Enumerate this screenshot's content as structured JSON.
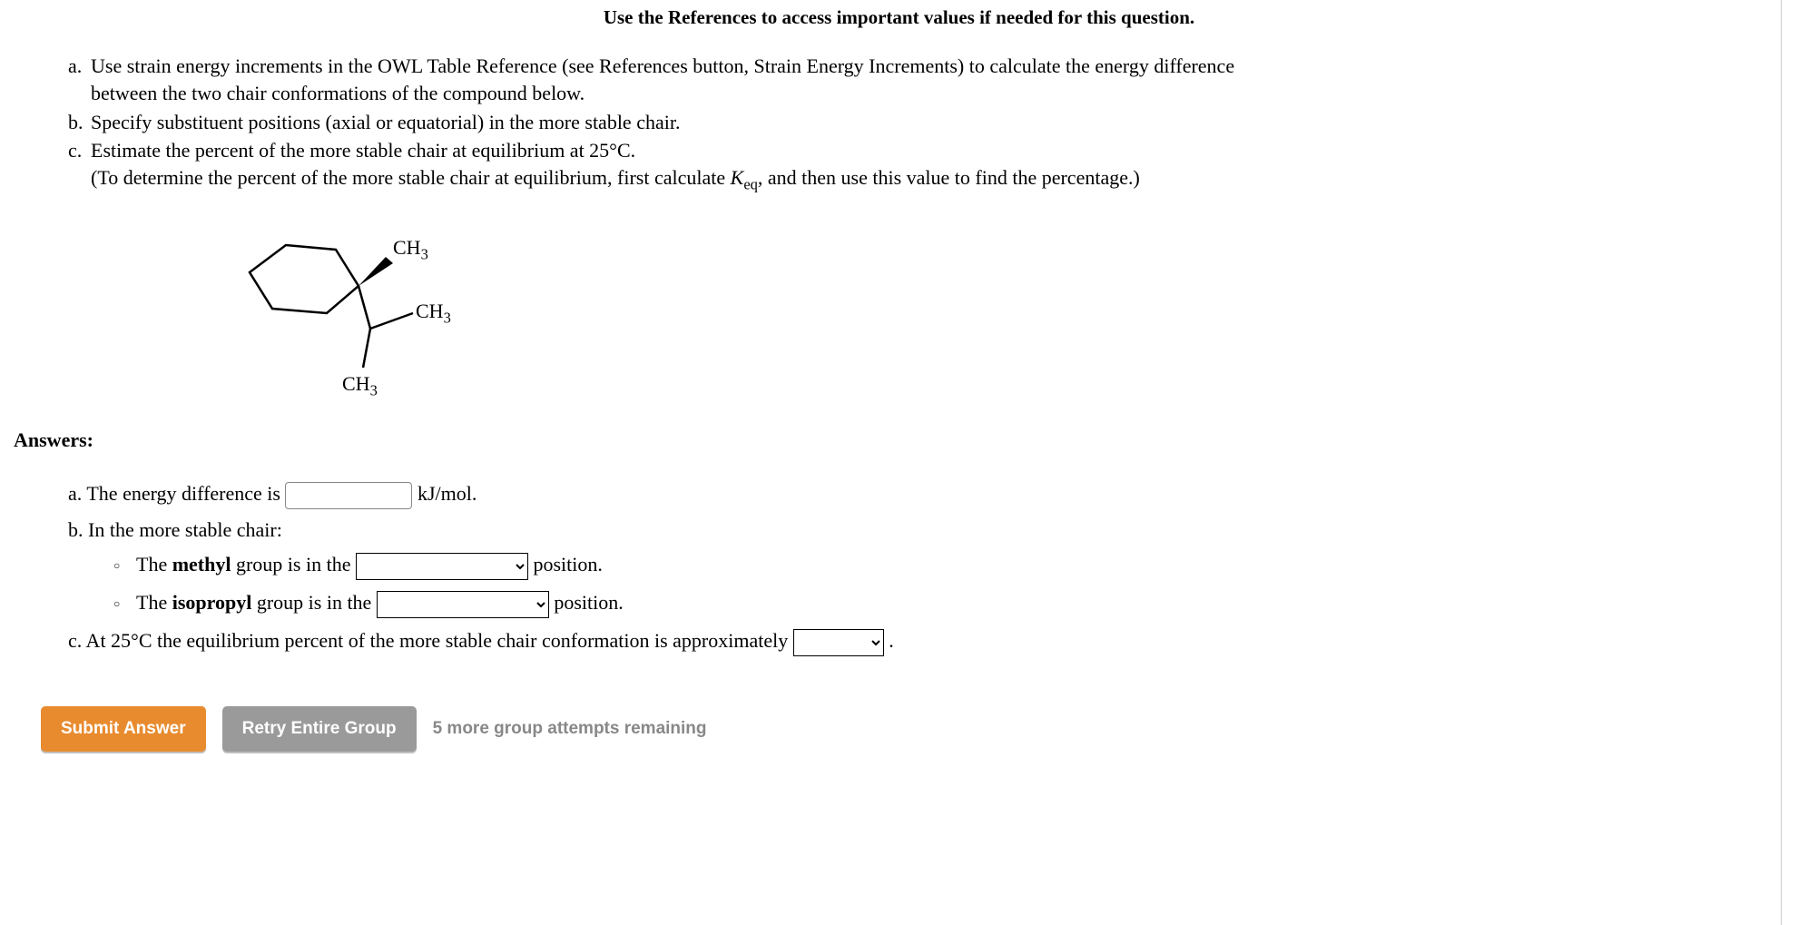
{
  "header": "Use the References to access important values if needed for this question.",
  "questions": {
    "a_letter": "a.",
    "a_text1": "Use strain energy increments in the OWL Table Reference (see References button, Strain Energy Increments) to calculate the energy difference",
    "a_text2": "between the two chair conformations of the compound below.",
    "b_letter": "b.",
    "b_text": "Specify substituent positions (axial or equatorial) in the more stable chair.",
    "c_letter": "c.",
    "c_text": "Estimate the percent of the more stable chair at equilibrium at 25°C.",
    "c_sub_pre": "(To determine the percent of the more stable chair at equilibrium, first calculate ",
    "c_sub_k": "K",
    "c_sub_eq": "eq",
    "c_sub_post": ", and then use this value to find the percentage.)"
  },
  "molecule": {
    "ch3_1": "CH",
    "ch3_2": "CH",
    "ch3_3": "CH",
    "sub3": "3"
  },
  "answers": {
    "header": "Answers:",
    "a_pre": "a. The energy difference is ",
    "a_post": " kJ/mol.",
    "b_intro": "b. In the more stable chair:",
    "b_methyl_pre": "The ",
    "b_methyl_bold": "methyl",
    "b_methyl_mid": " group is in the ",
    "b_methyl_post": " position.",
    "b_iso_pre": "The ",
    "b_iso_bold": "isopropyl",
    "b_iso_mid": " group is in the ",
    "b_iso_post": " position.",
    "c_pre": "c. At 25°C the equilibrium percent of the more stable chair conformation is approximately ",
    "c_post": "."
  },
  "buttons": {
    "submit": "Submit Answer",
    "retry": "Retry Entire Group",
    "attempts": "5 more group attempts remaining"
  }
}
